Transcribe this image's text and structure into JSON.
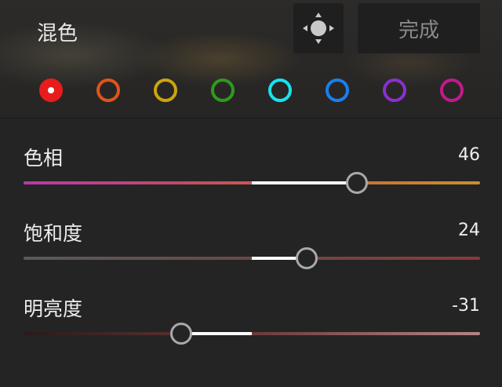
{
  "header": {
    "title": "混色",
    "target_tool_icon": "move-target-icon",
    "done_label": "完成"
  },
  "color_swatches": [
    {
      "name": "red",
      "color": "#e81c1c",
      "selected": true
    },
    {
      "name": "orange",
      "color": "#e0541a",
      "selected": false
    },
    {
      "name": "yellow",
      "color": "#c9a50f",
      "selected": false
    },
    {
      "name": "green",
      "color": "#2f9a1e",
      "selected": false
    },
    {
      "name": "aqua",
      "color": "#17e3f0",
      "selected": false
    },
    {
      "name": "blue",
      "color": "#1a7ef0",
      "selected": false
    },
    {
      "name": "purple",
      "color": "#8a2fd0",
      "selected": false
    },
    {
      "name": "magenta",
      "color": "#c21a8a",
      "selected": false
    }
  ],
  "sliders": [
    {
      "label": "色相",
      "value": "46",
      "value_num": 46,
      "min": -100,
      "max": 100,
      "track_colors": [
        "#b83aa8",
        "#c04a6a",
        "#c86a3a",
        "#c89030"
      ]
    },
    {
      "label": "饱和度",
      "value": "24",
      "value_num": 24,
      "min": -100,
      "max": 100,
      "track_colors": [
        "#5a5a5a",
        "#6a4848",
        "#8a3a3a"
      ]
    },
    {
      "label": "明亮度",
      "value": "-31",
      "value_num": -31,
      "min": -100,
      "max": 100,
      "track_colors": [
        "#2a1a1a",
        "#6a3a3a",
        "#b48484"
      ]
    }
  ]
}
